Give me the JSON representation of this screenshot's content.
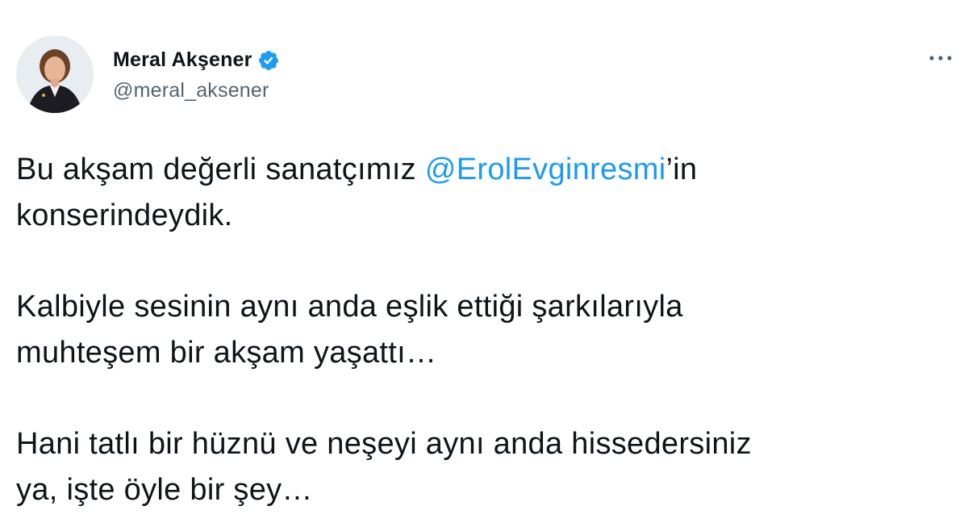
{
  "user": {
    "display_name": "Meral Akşener",
    "handle": "@meral_aksener",
    "verified": true
  },
  "menu": {
    "more_icon": "more-horizontal-icon"
  },
  "tweet": {
    "paragraph1": {
      "before_mention": "Bu akşam değerli sanatçımız ",
      "mention": "@ErolEvginresmi",
      "after_mention": "’in",
      "line2": "konserindeydik."
    },
    "paragraph2": {
      "line1": "Kalbiyle sesinin aynı anda eşlik ettiği şarkılarıyla",
      "line2": "muhteşem bir akşam yaşattı…"
    },
    "paragraph3": {
      "line1": "Hani tatlı bir hüznü ve neşeyi aynı anda hissedersiniz",
      "line2": "ya, işte öyle bir şey…"
    }
  },
  "colors": {
    "text": "#0f1419",
    "secondary": "#536471",
    "accent": "#1d9bf0"
  }
}
